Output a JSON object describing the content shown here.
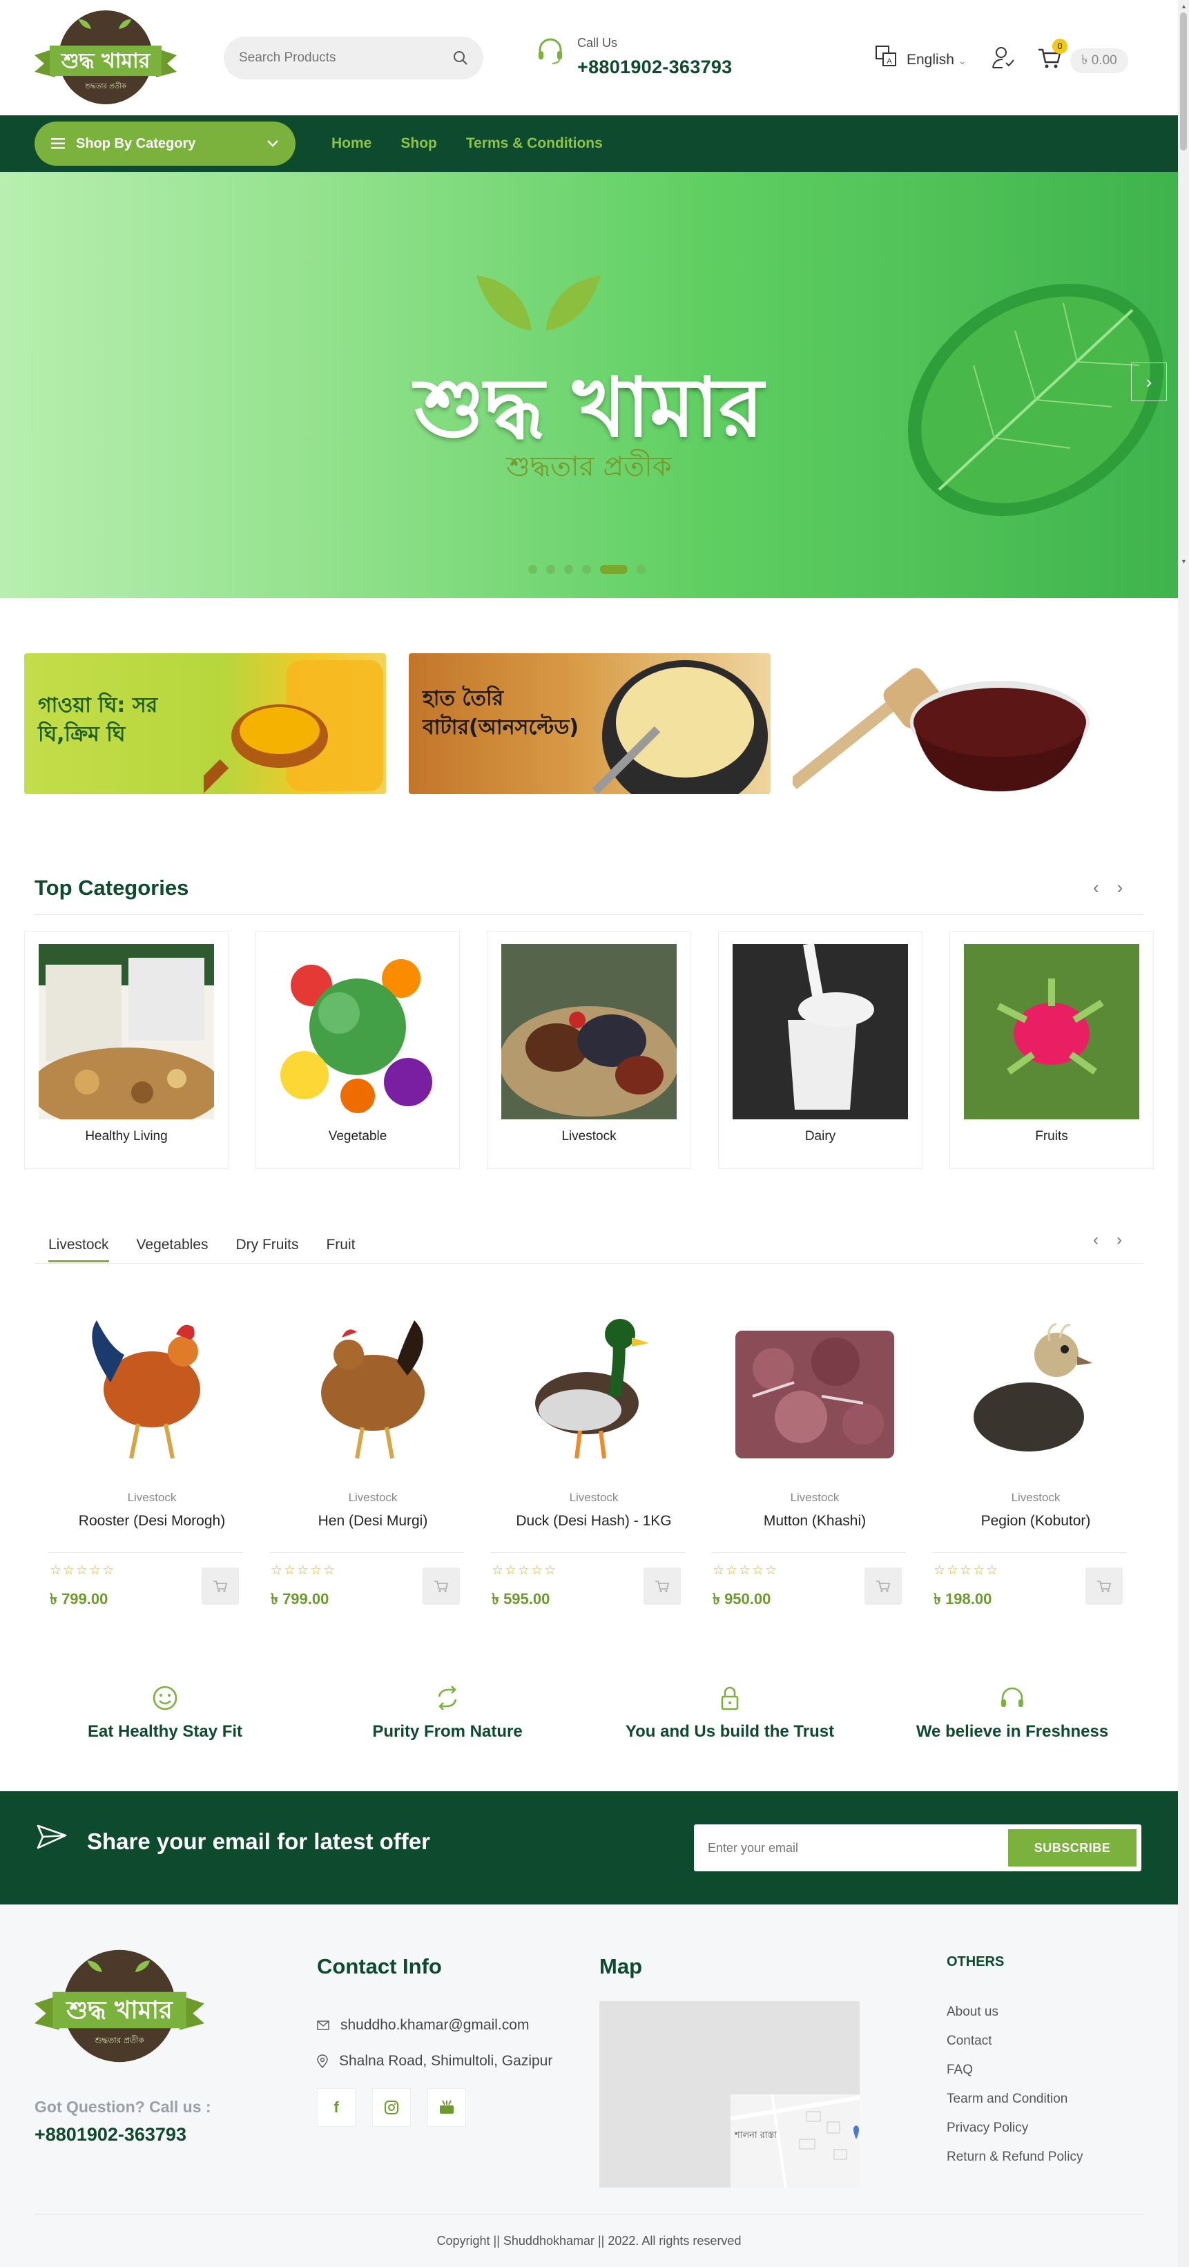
{
  "header": {
    "search_placeholder": "Search Products",
    "call_label": "Call Us",
    "call_number": "+8801902-363793",
    "language": "English",
    "cart_count": "0",
    "cart_total": "৳ 0.00"
  },
  "logo": {
    "text": "শুদ্ধ খামার",
    "tagline": "শুদ্ধতার প্রতীক"
  },
  "nav": {
    "category_button": "Shop By Category",
    "links": [
      "Home",
      "Shop",
      "Terms & Conditions"
    ]
  },
  "hero": {
    "title": "শুদ্ধ খামার",
    "subtitle": "শুদ্ধতার প্রতীক",
    "active_slide": 5,
    "slide_count": 6
  },
  "promos": [
    {
      "text": "গাওয়া ঘি: সর ঘি,ক্রিম ঘি"
    },
    {
      "text": "হাত তৈরি বাটার(আনসল্টেড)"
    },
    {
      "text": ""
    }
  ],
  "top_categories": {
    "title": "Top Categories",
    "items": [
      "Healthy Living",
      "Vegetable",
      "Livestock",
      "Dairy",
      "Fruits"
    ]
  },
  "product_tabs": [
    "Livestock",
    "Vegetables",
    "Dry Fruits",
    "Fruit"
  ],
  "products": [
    {
      "category": "Livestock",
      "name": "Rooster (Desi Morogh)",
      "price": "৳ 799.00",
      "stars": "☆☆☆☆☆"
    },
    {
      "category": "Livestock",
      "name": "Hen (Desi Murgi)",
      "price": "৳ 799.00",
      "stars": "☆☆☆☆☆"
    },
    {
      "category": "Livestock",
      "name": "Duck (Desi Hash) - 1KG",
      "price": "৳ 595.00",
      "stars": "☆☆☆☆☆"
    },
    {
      "category": "Livestock",
      "name": "Mutton (Khashi)",
      "price": "৳ 950.00",
      "stars": "☆☆☆☆☆"
    },
    {
      "category": "Livestock",
      "name": "Pegion (Kobutor)",
      "price": "৳ 198.00",
      "stars": "☆☆☆☆☆"
    }
  ],
  "features": [
    "Eat Healthy Stay Fit",
    "Purity From Nature",
    "You and Us build the Trust",
    "We believe in Freshness"
  ],
  "newsletter": {
    "title": "Share your email for latest offer",
    "placeholder": "Enter your email",
    "button": "SUBSCRIBE"
  },
  "footer": {
    "question": "Got Question? Call us :",
    "phone": "+8801902-363793",
    "contact_title": "Contact Info",
    "email": "shuddho.khamar@gmail.com",
    "address": "Shalna Road, Shimultoli, Gazipur",
    "map_title": "Map",
    "map_label": "শালনা রাস্তা",
    "others_title": "OTHERS",
    "others_links": [
      "About us",
      "Contact",
      "FAQ",
      "Tearm and Condition",
      "Privacy Policy",
      "Return & Refund Policy"
    ],
    "copyright": "Copyright || Shuddhokhamar || 2022. All rights reserved"
  },
  "colors": {
    "brand_dark": "#0e4a2e",
    "brand_green": "#7bb13d",
    "star": "#f1b211"
  }
}
